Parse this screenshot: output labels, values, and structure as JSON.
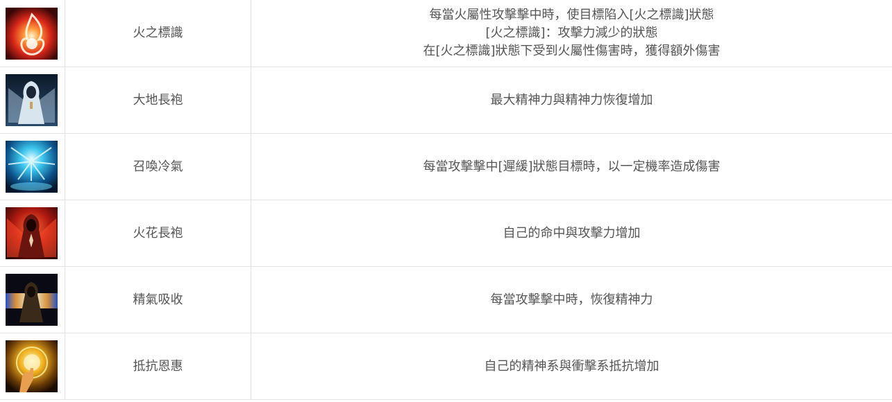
{
  "skills": [
    {
      "icon": "flame-mark-icon",
      "name": "火之標識",
      "desc": [
        "每當火屬性攻擊擊中時，使目標陷入[火之標識]狀態",
        "[火之標識]：攻擊力減少的狀態",
        "在[火之標識]狀態下受到火屬性傷害時，獲得額外傷害"
      ]
    },
    {
      "icon": "earth-robe-icon",
      "name": "大地長袍",
      "desc": [
        "最大精神力與精神力恢復增加"
      ]
    },
    {
      "icon": "frost-summon-icon",
      "name": "召喚冷氣",
      "desc": [
        "每當攻擊擊中[遲緩]狀態目標時，以一定機率造成傷害"
      ]
    },
    {
      "icon": "fire-robe-icon",
      "name": "火花長袍",
      "desc": [
        "自己的命中與攻擊力增加"
      ]
    },
    {
      "icon": "spirit-absorb-icon",
      "name": "精氣吸收",
      "desc": [
        "每當攻擊擊中時，恢復精神力"
      ]
    },
    {
      "icon": "resist-grace-icon",
      "name": "抵抗恩惠",
      "desc": [
        "自己的精神系與衝擊系抵抗增加"
      ]
    }
  ]
}
